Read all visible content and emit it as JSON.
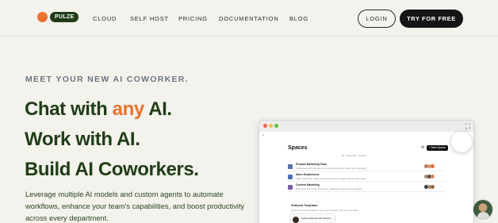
{
  "header": {
    "logo_text": "PULZE",
    "nav": [
      "CLOUD",
      "SELF HOST",
      "PRICING",
      "DOCUMENTATION",
      "BLOG"
    ],
    "login_label": "LOGIN",
    "cta_label": "TRY FOR FREE"
  },
  "hero": {
    "eyebrow": "MEET YOUR NEW AI COWORKER.",
    "line1_pre": "Chat with ",
    "line1_accent": "any",
    "line1_post": " AI.",
    "line2": "Work with AI.",
    "line3": "Build AI Coworkers.",
    "description": "Leverage multiple AI models and custom agents to automate workflows, enhance your team's capabilities, and boost productivity across every department."
  },
  "preview": {
    "title": "Spaces",
    "new_button": "+ New Space",
    "tabs": "All  ·  Favorited  ·  Shared",
    "rows": [
      {
        "name": "Product Marketing Team",
        "desc": "Collaborate with your team to craft product launch plans and messaging",
        "icon_color": "#5b6fa8"
      },
      {
        "name": "Sales Enablement",
        "desc": "Share playbooks, battlecards and customer insights with the sales team",
        "icon_color": "#4a6fb0"
      },
      {
        "name": "Content Marketing",
        "desc": "Plan, draft and review blog posts, newsletters and social campaigns",
        "icon_color": "#7c5ca8"
      }
    ],
    "featured_title": "Featured Templates",
    "featured_desc": "Explore curated templates to get started quickly with your new space",
    "card_text": "Getting Started with Spaces"
  },
  "colors": {
    "background": "#f3f2ec",
    "brand_green": "#1f3d16",
    "accent_orange": "#e9732f",
    "cta_black": "#151515"
  }
}
